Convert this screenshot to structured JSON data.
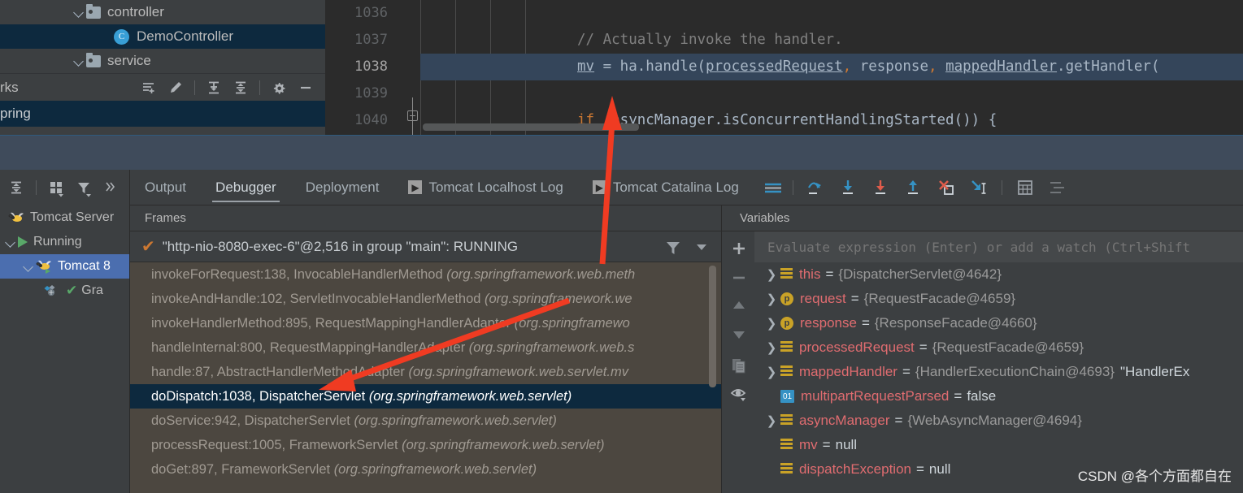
{
  "project_tree": {
    "rows": [
      {
        "label": "controller",
        "icon": "folder-icon",
        "selected": false,
        "indent": 88
      },
      {
        "label": "DemoController",
        "icon": "class-icon",
        "selected": true,
        "indent": 140
      },
      {
        "label": "service",
        "icon": "folder-icon",
        "selected": false,
        "indent": 88
      }
    ]
  },
  "bookmarks": {
    "title": "rks",
    "icons": [
      "add-bookmark-icon",
      "edit-icon",
      "expand-all-icon",
      "collapse-all-icon",
      "settings-gear-icon",
      "hide-icon"
    ],
    "item": "pring"
  },
  "editor": {
    "line_numbers": [
      "1036",
      "1037",
      "1038",
      "1039",
      "1040"
    ],
    "current_line": "1038",
    "lines": [
      {
        "num": "1036",
        "text": "",
        "highlight": false
      },
      {
        "num": "1037",
        "text": "// Actually invoke the handler.",
        "highlight": false
      },
      {
        "num": "1038",
        "text": "mv = ha.handle(processedRequest, response, mappedHandler.getHandler(",
        "highlight": true
      },
      {
        "num": "1039",
        "text": "",
        "highlight": false
      },
      {
        "num": "1040",
        "text": "if (asyncManager.isConcurrentHandlingStarted()) {",
        "highlight": false
      }
    ],
    "code_1037_comment": "// Actually invoke the handler.",
    "code_1038": {
      "var": "mv",
      "mid": " = ha.handle(",
      "arg1": "processedRequest",
      "comma1": ", ",
      "arg2": "response",
      "comma2": ", ",
      "arg3": "mappedHandler",
      "tail": ".getHandler("
    },
    "code_1040": {
      "kw": "if",
      "rest": " (asyncManager.isConcurrentHandlingStarted()) {"
    }
  },
  "services": {
    "toolbar_icons": [
      "collapse-all-icon",
      "group-by-icon",
      "filter-icon",
      "more-icon"
    ],
    "rows": [
      {
        "label": "Tomcat Server",
        "icon": "tomcat-icon",
        "selected": false,
        "indent": 10,
        "chevron": false
      },
      {
        "label": "Running",
        "icon": "run-icon",
        "selected": false,
        "indent": 4,
        "chevron": true
      },
      {
        "label": "Tomcat 8",
        "icon": "tomcat-icon",
        "selected": true,
        "indent": 26,
        "chevron": true
      },
      {
        "label": "Gra",
        "icon": "deploy-icon",
        "selected": false,
        "indent": 54,
        "chevron": false
      }
    ]
  },
  "tabs": [
    {
      "label": "Output",
      "active": false,
      "icon": null
    },
    {
      "label": "Debugger",
      "active": true,
      "icon": null
    },
    {
      "label": "Deployment",
      "active": false,
      "icon": null
    },
    {
      "label": "Tomcat Localhost Log",
      "active": false,
      "icon": "run-console-icon"
    },
    {
      "label": "Tomcat Catalina Log",
      "active": false,
      "icon": "run-console-icon"
    }
  ],
  "debug_toolbar_icons": [
    "layout-lines-icon",
    "step-over-icon",
    "step-into-icon",
    "force-step-into-icon",
    "step-out-icon",
    "drop-frame-icon",
    "run-to-cursor-icon",
    "evaluate-expression-icon",
    "settings-list-icon"
  ],
  "frames": {
    "header": "Frames",
    "thread": "\"http-nio-8080-exec-6\"@2,516 in group \"main\": RUNNING",
    "thread_icons": [
      "filter-icon",
      "chevron-down-icon"
    ],
    "rows": [
      {
        "method": "invokeForRequest:138, InvocableHandlerMethod ",
        "pkg": "(org.springframework.web.meth",
        "selected": false
      },
      {
        "method": "invokeAndHandle:102, ServletInvocableHandlerMethod ",
        "pkg": "(org.springframework.we",
        "selected": false
      },
      {
        "method": "invokeHandlerMethod:895, RequestMappingHandlerAdapter ",
        "pkg": "(org.springframewo",
        "selected": false
      },
      {
        "method": "handleInternal:800, RequestMappingHandlerAdapter ",
        "pkg": "(org.springframework.web.s",
        "selected": false
      },
      {
        "method": "handle:87, AbstractHandlerMethodAdapter ",
        "pkg": "(org.springframework.web.servlet.mv",
        "selected": false
      },
      {
        "method": "doDispatch:1038, DispatcherServlet ",
        "pkg": "(org.springframework.web.servlet)",
        "selected": true
      },
      {
        "method": "doService:942, DispatcherServlet ",
        "pkg": "(org.springframework.web.servlet)",
        "selected": false
      },
      {
        "method": "processRequest:1005, FrameworkServlet ",
        "pkg": "(org.springframework.web.servlet)",
        "selected": false
      },
      {
        "method": "doGet:897, FrameworkServlet ",
        "pkg": "(org.springframework.web.servlet)",
        "selected": false
      }
    ]
  },
  "variables": {
    "header": "Variables",
    "gutter_icons": [
      "add-watch-icon",
      "remove-watch-icon",
      "move-up-icon",
      "move-down-icon",
      "copy-icon",
      "eye-icon"
    ],
    "evaluate_placeholder": "Evaluate expression (Enter) or add a watch (Ctrl+Shift",
    "rows": [
      {
        "expandable": true,
        "icon": "object-icon",
        "name": "this",
        "value": "{DispatcherServlet@4642}",
        "extra": ""
      },
      {
        "expandable": true,
        "icon": "param-icon",
        "name": "request",
        "value": "{RequestFacade@4659}",
        "extra": ""
      },
      {
        "expandable": true,
        "icon": "param-icon",
        "name": "response",
        "value": "{ResponseFacade@4660}",
        "extra": ""
      },
      {
        "expandable": true,
        "icon": "object-icon",
        "name": "processedRequest",
        "value": "{RequestFacade@4659}",
        "extra": ""
      },
      {
        "expandable": true,
        "icon": "object-icon",
        "name": "mappedHandler",
        "value": "{HandlerExecutionChain@4693}",
        "extra": "\"HandlerEx"
      },
      {
        "expandable": false,
        "icon": "boolean-icon",
        "name": "multipartRequestParsed",
        "value": "false",
        "extra": ""
      },
      {
        "expandable": true,
        "icon": "object-icon",
        "name": "asyncManager",
        "value": "{WebAsyncManager@4694}",
        "extra": ""
      },
      {
        "expandable": false,
        "icon": "object-icon",
        "name": "mv",
        "value": "null",
        "extra": ""
      },
      {
        "expandable": false,
        "icon": "object-icon",
        "name": "dispatchException",
        "value": "null",
        "extra": ""
      }
    ]
  },
  "watermark": "CSDN @各个方面都自在",
  "colors": {
    "selection_blue": "#0d293e",
    "tree_selection": "#4b6eaf",
    "frames_bg": "#4c4740",
    "editor_bg": "#2b2b2b",
    "panel_bg": "#3c3f41",
    "var_name": "#e06c70",
    "arrow_red": "#f03b22",
    "accent_blue": "#3592c4"
  }
}
